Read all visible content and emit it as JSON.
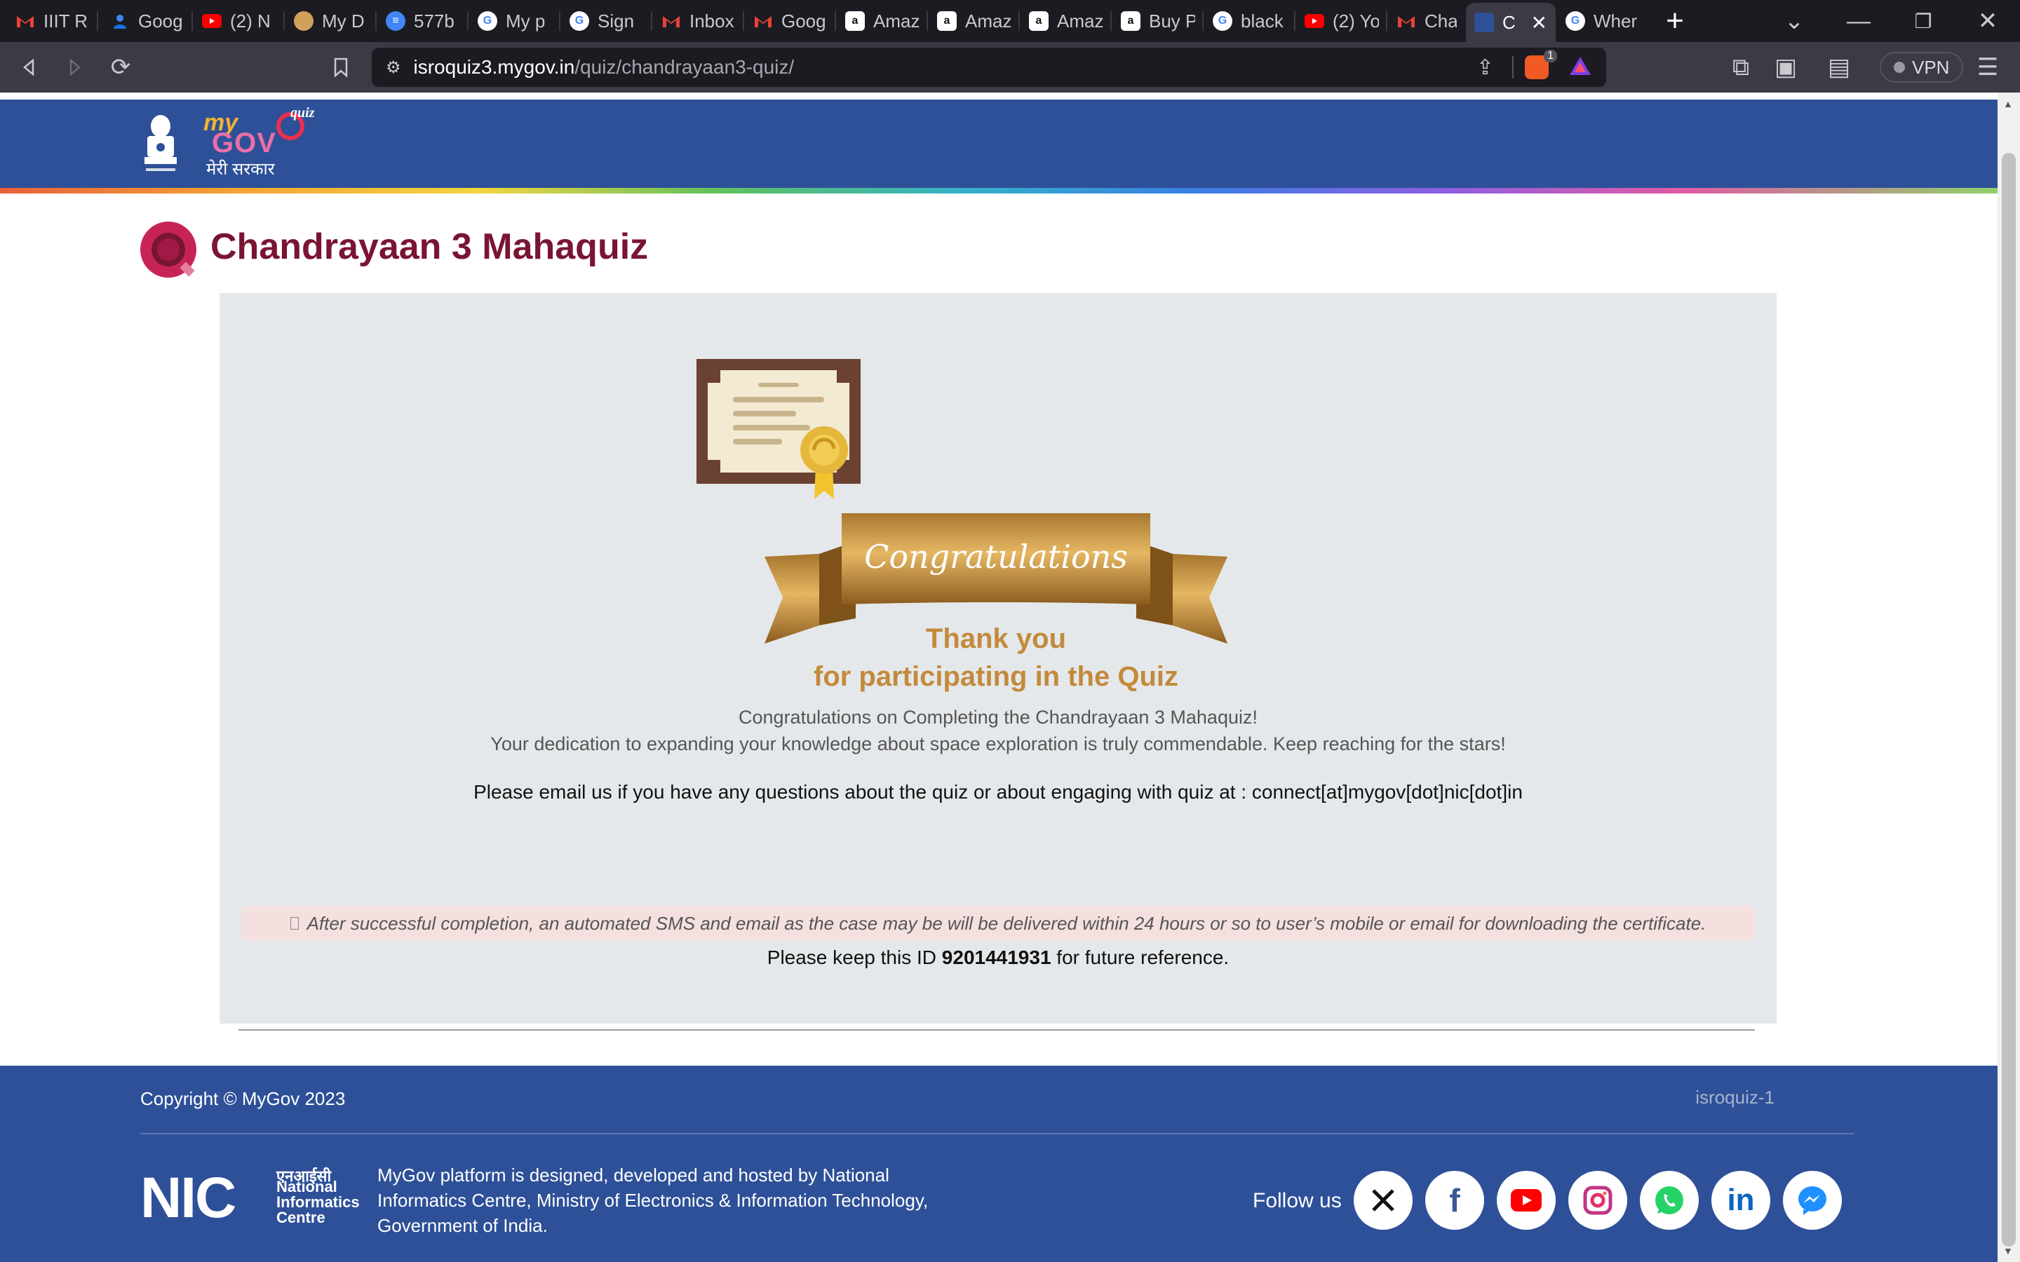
{
  "browser": {
    "tabs": [
      {
        "title": "IIIT R",
        "icon": "gmail-icon"
      },
      {
        "title": "Goog",
        "icon": "google-contacts-icon"
      },
      {
        "title": "(2) N",
        "icon": "youtube-icon"
      },
      {
        "title": "My D",
        "icon": "avatar-icon"
      },
      {
        "title": "577b",
        "icon": "docs-icon"
      },
      {
        "title": "My p",
        "icon": "google-icon"
      },
      {
        "title": "Sign",
        "icon": "google-icon"
      },
      {
        "title": "Inbox",
        "icon": "gmail-icon"
      },
      {
        "title": "Goog",
        "icon": "gmail-icon"
      },
      {
        "title": "Amaz",
        "icon": "amazon-icon"
      },
      {
        "title": "Amaz",
        "icon": "amazon-icon"
      },
      {
        "title": "Amaz",
        "icon": "amazon-icon"
      },
      {
        "title": "Buy P",
        "icon": "amazon-icon"
      },
      {
        "title": "black",
        "icon": "google-icon"
      },
      {
        "title": "(2) Yo",
        "icon": "youtube-icon"
      },
      {
        "title": "Chan",
        "icon": "gmail-icon"
      },
      {
        "title": "C",
        "icon": "mygov-favicon",
        "active": true
      },
      {
        "title": "Wher",
        "icon": "google-icon"
      }
    ],
    "url_host": "isroquiz3.mygov.in",
    "url_path": "/quiz/chandrayaan3-quiz/",
    "brave_badge": "1",
    "vpn_label": "VPN"
  },
  "header": {
    "logo_my": "my",
    "logo_gov": "GOV",
    "logo_quiz": "quiz",
    "hindi": "मेरी सरकार"
  },
  "quiz": {
    "title": "Chandrayaan 3 Mahaquiz",
    "ribbon_text": "Congratulations",
    "thank_you_line1": "Thank you",
    "thank_you_line2": "for participating in the Quiz",
    "congrats_line": "Congratulations on Completing the Chandrayaan 3 Mahaquiz!",
    "dedication_line": "Your dedication to expanding your knowledge about space exploration is truly commendable. Keep reaching for the stars!",
    "email_line": "Please email us if you have any questions about the quiz or about engaging with quiz at : connect[at]mygov[dot]nic[dot]in",
    "note": "After successful completion, an automated SMS and email as the case may be will be delivered within 24 hours or so to user’s mobile or email for downloading the certificate.",
    "ref_prefix": "Please keep this ID ",
    "ref_id": "9201441931",
    "ref_suffix": " for future reference."
  },
  "footer": {
    "copyright": "Copyright © MyGov 2023",
    "build_tag": "isroquiz-1",
    "nic_description": "MyGov platform is designed, developed and hosted by National Informatics Centre, Ministry of Electronics & Information Technology, Government of India.",
    "nic_logo_text": "NIC",
    "nic_hindi": "एनआईसी",
    "nic_name_line1": "National",
    "nic_name_line2": "Informatics",
    "nic_name_line3": "Centre",
    "follow_label": "Follow us",
    "social": [
      "x-icon",
      "facebook-icon",
      "youtube-icon",
      "instagram-icon",
      "whatsapp-icon",
      "linkedin-icon",
      "messenger-icon"
    ]
  },
  "colors": {
    "header_blue": "#2e5098",
    "title_maroon": "#7a1433",
    "card_bg": "#e5e8ea",
    "gold": "#c38a3c"
  }
}
